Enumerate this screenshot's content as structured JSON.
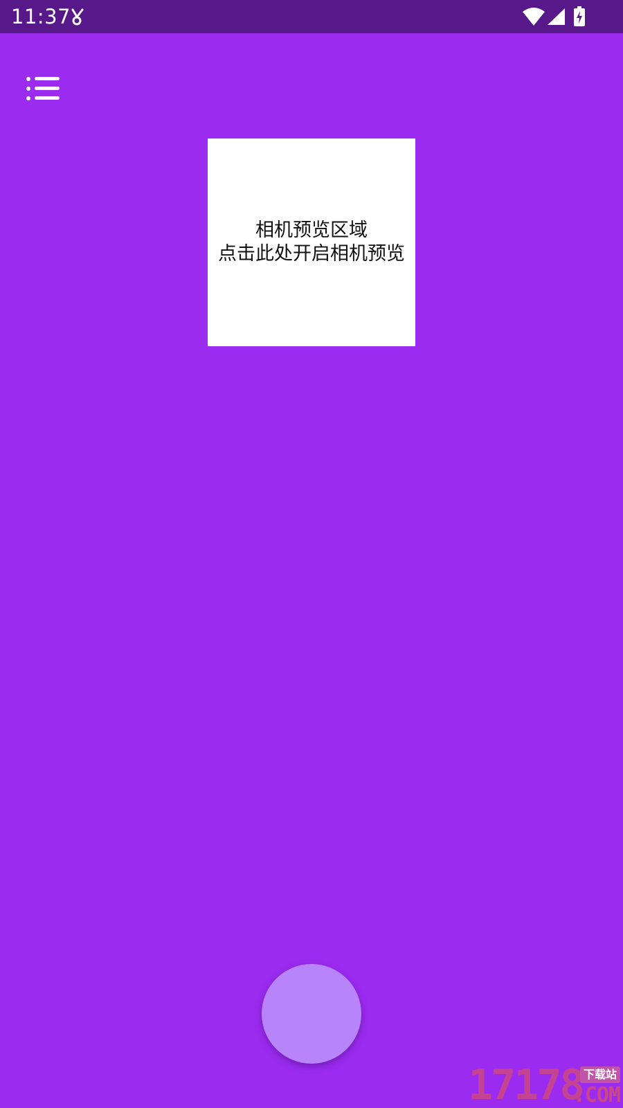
{
  "status_bar": {
    "time": "11:37",
    "icons": [
      "notification-icon",
      "wifi-icon",
      "signal-icon",
      "battery-charging-icon"
    ]
  },
  "toolbar": {
    "menu_icon": "menu-icon"
  },
  "preview": {
    "line1": "相机预览区域",
    "line2": "点击此处开启相机预览"
  },
  "capture": {
    "icon": "capture-button"
  },
  "watermark": {
    "digits": "17178",
    "badge": "下载站",
    "suffix": ".COM"
  },
  "colors": {
    "background": "#9b2bef",
    "status_bar": "#57188a",
    "capture_button": "#b884fa",
    "preview_box": "#ffffff"
  }
}
